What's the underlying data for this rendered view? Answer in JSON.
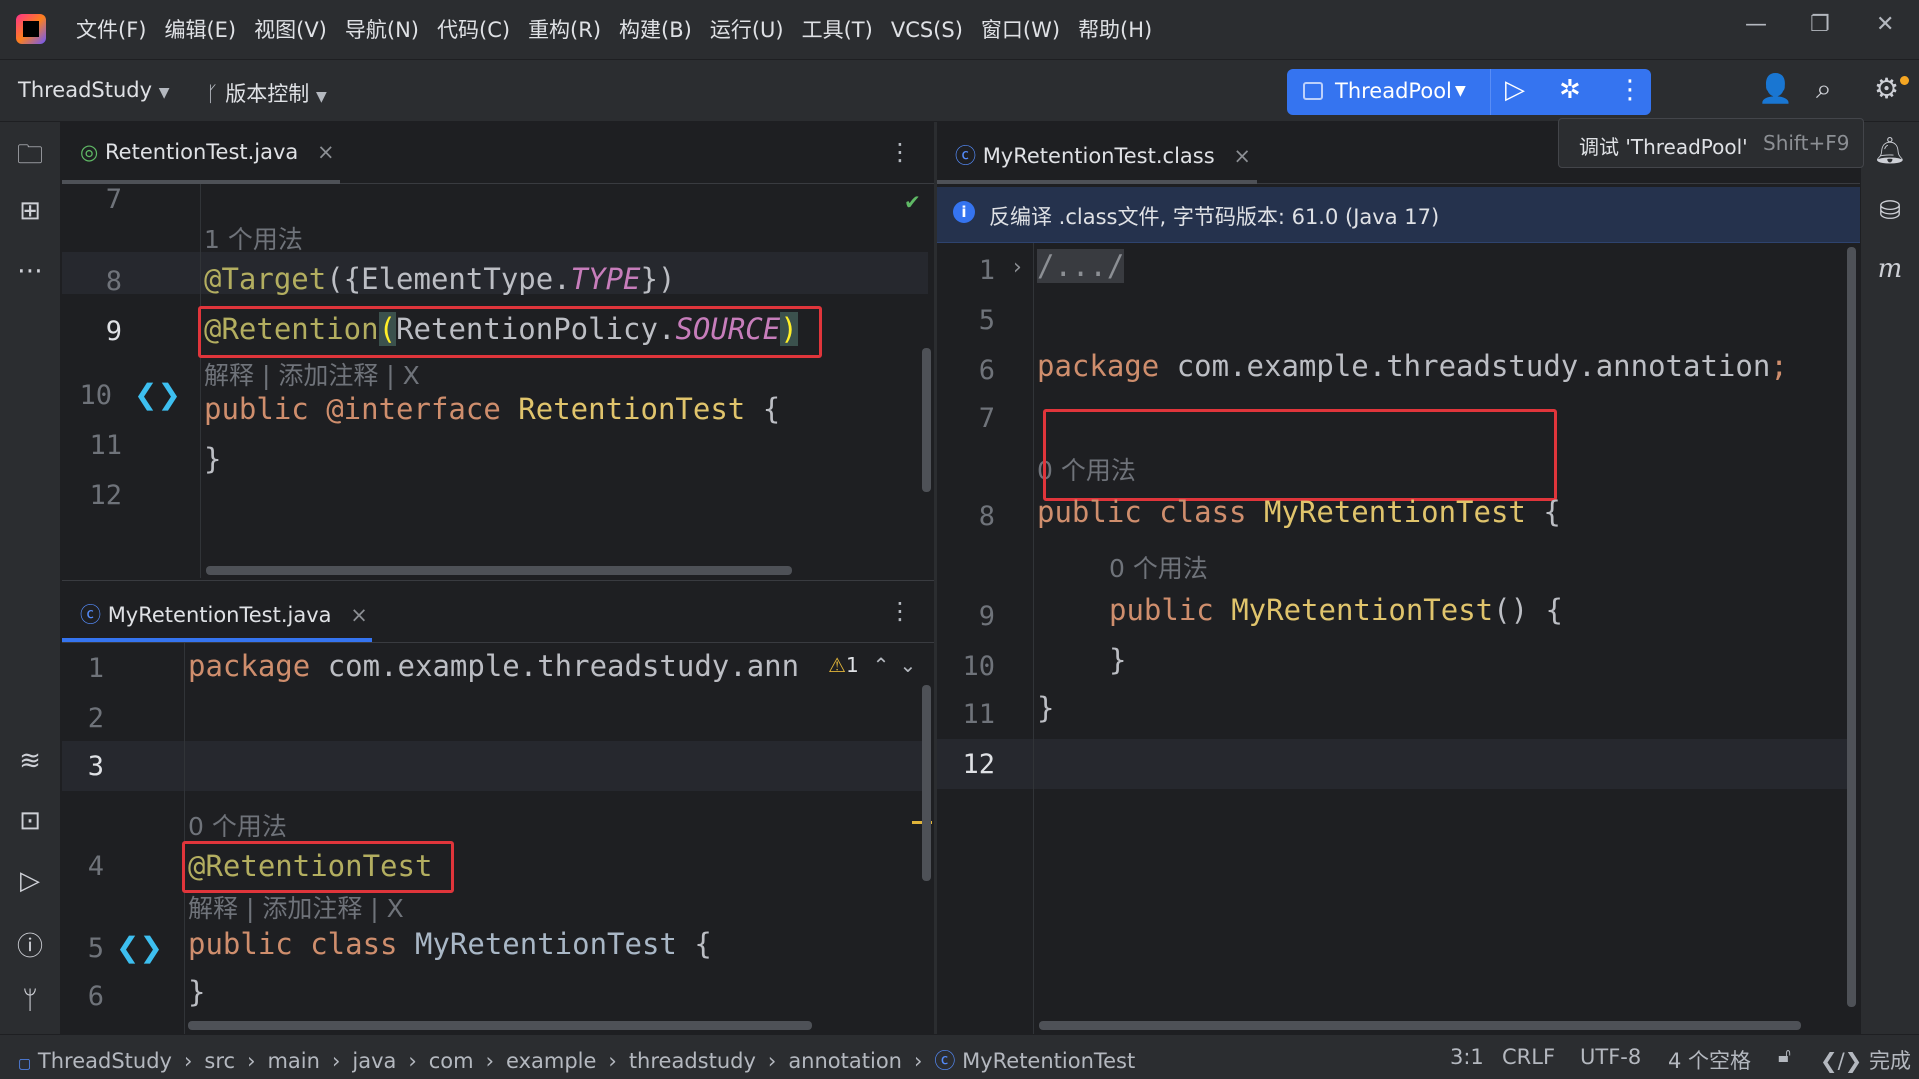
{
  "menu": [
    "文件(F)",
    "编辑(E)",
    "视图(V)",
    "导航(N)",
    "代码(C)",
    "重构(R)",
    "构建(B)",
    "运行(U)",
    "工具(T)",
    "VCS(S)",
    "窗口(W)",
    "帮助(H)"
  ],
  "toolbar": {
    "project": "ThreadStudy",
    "vcs": "版本控制",
    "run_config": "ThreadPool"
  },
  "tooltip": {
    "text": "调试 'ThreadPool'",
    "shortcut": "Shift+F9"
  },
  "top_left": {
    "tab": "RetentionTest.java",
    "lines": [
      "7",
      "8",
      "9",
      "10",
      "11",
      "12"
    ],
    "hint_usages": "1 个用法",
    "hint_actions": "解释 | 添加注释 | X",
    "code": {
      "l8a": "@Target",
      "l8b": "({ElementType.",
      "l8c": "TYPE",
      "l8d": "})",
      "l9a": "@Retention",
      "l9b": "(",
      "l9c": "RetentionPolicy.",
      "l9d": "SOURCE",
      "l9e": ")",
      "l10a": "public ",
      "l10b": "@interface ",
      "l10c": "RetentionTest",
      "l10d": " {",
      "l11": "}"
    }
  },
  "bottom_left": {
    "tab": "MyRetentionTest.java",
    "lines": [
      "1",
      "2",
      "3",
      "4",
      "5",
      "6"
    ],
    "warn": "1",
    "hint_usages": "0 个用法",
    "hint_actions": "解释 | 添加注释 | X",
    "code": {
      "l1a": "package ",
      "l1b": "com.example.threadstudy.ann",
      "l4": "@RetentionTest",
      "l5a": "public class ",
      "l5b": "MyRetentionTest",
      "l5c": " {",
      "l6": "}"
    }
  },
  "right": {
    "tab": "MyRetentionTest.class",
    "banner": "反编译 .class文件, 字节码版本: 61.0 (Java 17)",
    "lines": [
      "1",
      "5",
      "6",
      "7",
      "8",
      "9",
      "10",
      "11",
      "12"
    ],
    "hint1": "0 个用法",
    "hint2": "0 个用法",
    "code": {
      "l1": "/.../",
      "l6a": "package ",
      "l6b": "com.example.threadstudy.annotation",
      "l6c": ";",
      "l8a": "public class ",
      "l8b": "MyRetentionTest",
      "l8c": " {",
      "l9a": "public ",
      "l9b": "MyRetentionTest",
      "l9c": "() {",
      "l10": "}",
      "l11": "}"
    }
  },
  "status": {
    "crumbs": [
      "ThreadStudy",
      "src",
      "main",
      "java",
      "com",
      "example",
      "threadstudy",
      "annotation",
      "MyRetentionTest"
    ],
    "pos": "3:1",
    "eol": "CRLF",
    "enc": "UTF-8",
    "indent": "4 个空格",
    "done": "完成"
  }
}
